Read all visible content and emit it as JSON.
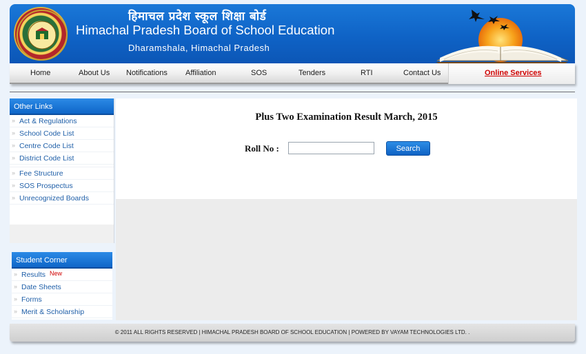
{
  "header": {
    "title_hindi": "हिमाचल प्रदेश स्कूल शिक्षा बोर्ड",
    "title": "Himachal Pradesh Board of School Education",
    "subtitle": "Dharamshala, Himachal Pradesh"
  },
  "nav": {
    "items": [
      "Home",
      "About Us",
      "Notifications",
      "Affiliation",
      "SOS",
      "Tenders",
      "RTI",
      "Contact Us"
    ],
    "online_services": "Online Services"
  },
  "sidebar": {
    "other_links": {
      "title": "Other Links",
      "items": [
        "Act & Regulations",
        "School Code List",
        "Centre Code List",
        "District Code List",
        "Fee Structure",
        "SOS Prospectus",
        "Unrecognized Boards"
      ]
    },
    "student_corner": {
      "title": "Student Corner",
      "items": [
        "Results",
        "Date Sheets",
        "Forms",
        "Merit & Scholarship"
      ],
      "new_badge": "New"
    }
  },
  "main": {
    "title": "Plus Two Examination Result March, 2015",
    "roll_label": "Roll No :",
    "roll_value": "",
    "search_label": "Search"
  },
  "footer": {
    "text": "© 2011 ALL RIGHTS RESERVED | HIMACHAL PRADESH BOARD OF SCHOOL EDUCATION | POWERED BY VAYAM TECHNOLOGIES LTD. ."
  },
  "colors": {
    "header_blue": "#0f63c6",
    "link_blue": "#1f5fa8",
    "accent_red": "#d00000"
  }
}
